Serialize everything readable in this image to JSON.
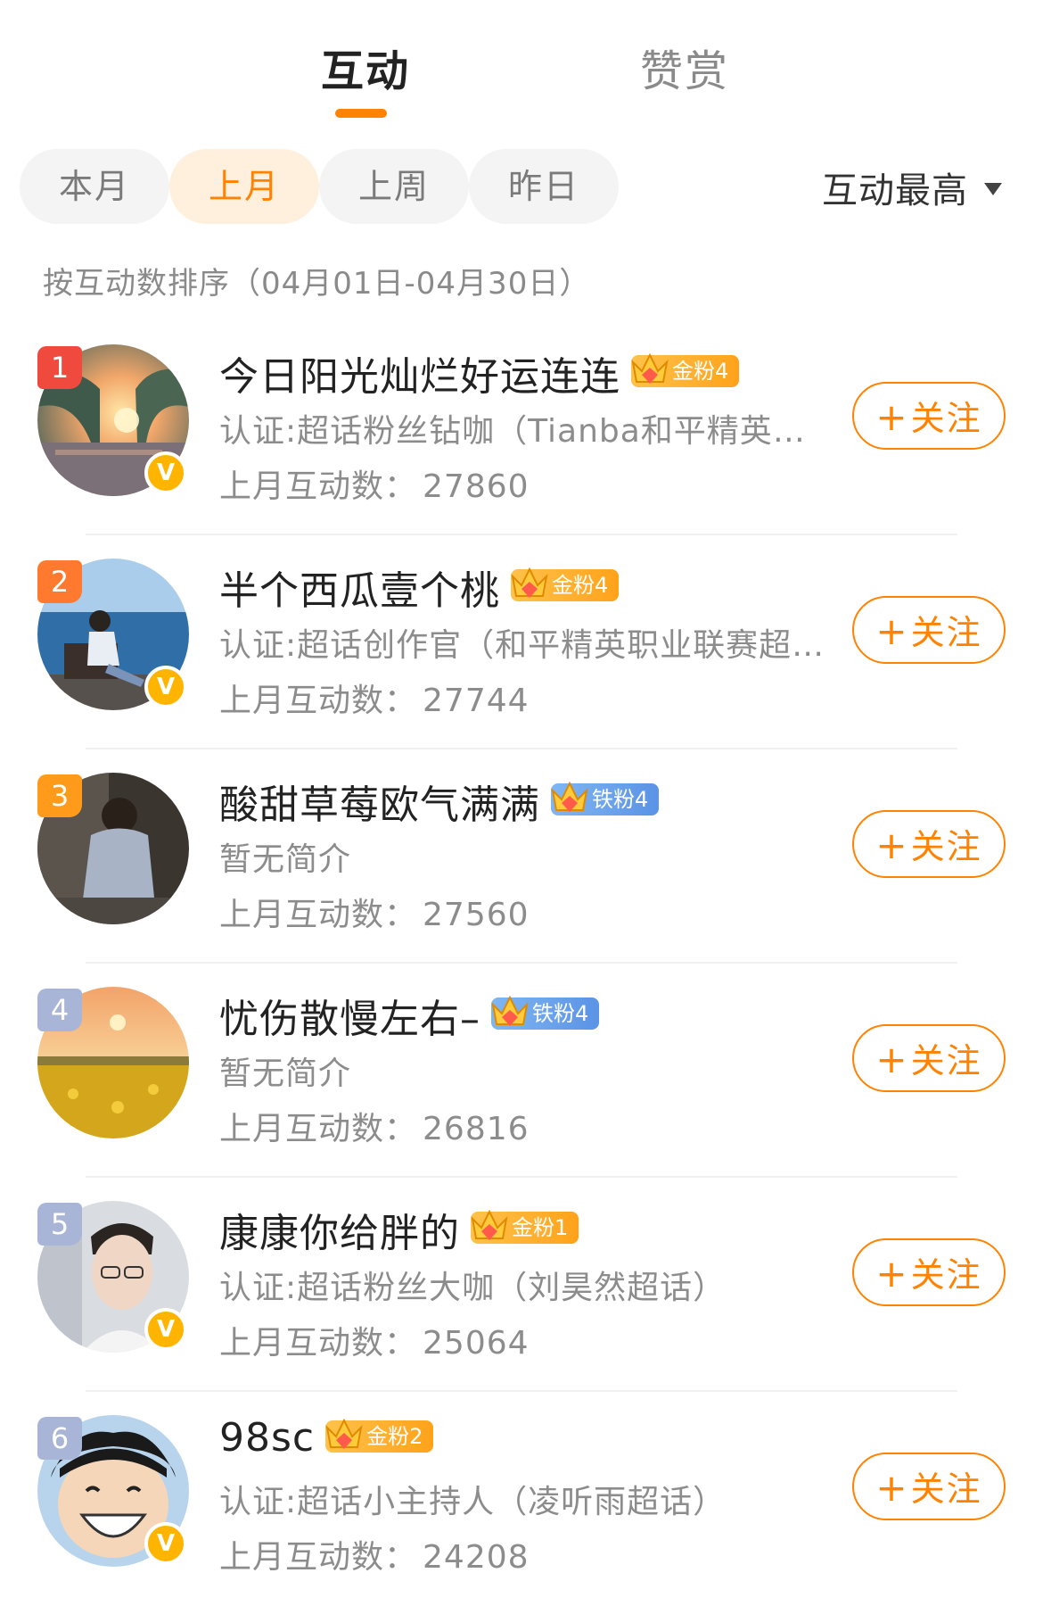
{
  "tabs": [
    {
      "label": "互动",
      "active": true
    },
    {
      "label": "赞赏",
      "active": false
    }
  ],
  "filters": {
    "chips": [
      {
        "label": "本月",
        "active": false
      },
      {
        "label": "上月",
        "active": true
      },
      {
        "label": "上周",
        "active": false
      },
      {
        "label": "昨日",
        "active": false
      }
    ],
    "sort_label": "互动最高"
  },
  "sort_description": "按互动数排序（04月01日-04月30日）",
  "follow_label": "关注",
  "count_prefix": "上月互动数：",
  "colors": {
    "accent": "#ff8200",
    "rank1": "#f04a3f",
    "rank2": "#ff7a2e",
    "rank3": "#ff9a1a",
    "rank_other": "#a9b5d6",
    "gold_badge": "#ffa21a",
    "iron_badge": "#5b93e6",
    "verified": "#ffb400"
  },
  "users": [
    {
      "rank": "1",
      "name": "今日阳光灿烂好运连连",
      "badge": "金粉4",
      "badge_type": "gold",
      "desc": "认证:超话粉丝钻咖（Tianba和平精英超话）",
      "count": "27860",
      "verified": true,
      "avatar": "sunset-trees"
    },
    {
      "rank": "2",
      "name": "半个西瓜壹个桃",
      "badge": "金粉4",
      "badge_type": "gold",
      "desc": "认证:超话创作官（和平精英职业联赛超话）",
      "count": "27744",
      "verified": true,
      "avatar": "sea-bench"
    },
    {
      "rank": "3",
      "name": "酸甜草莓欧气满满",
      "badge": "铁粉4",
      "badge_type": "iron",
      "desc": "暂无简介",
      "count": "27560",
      "verified": false,
      "avatar": "girl-sitting"
    },
    {
      "rank": "4",
      "name": "忧伤散慢左右–",
      "badge": "铁粉4",
      "badge_type": "iron",
      "desc": "暂无简介",
      "count": "26816",
      "verified": false,
      "avatar": "rapeseed-field"
    },
    {
      "rank": "5",
      "name": "康康你给胖的",
      "badge": "金粉1",
      "badge_type": "gold",
      "desc": "认证:超话粉丝大咖（刘昊然超话）",
      "count": "25064",
      "verified": true,
      "avatar": "young-man"
    },
    {
      "rank": "6",
      "name": "98sc",
      "badge": "金粉2",
      "badge_type": "gold",
      "desc": "认证:超话小主持人（凌听雨超话）",
      "count": "24208",
      "verified": true,
      "avatar": "anime-smile"
    }
  ]
}
